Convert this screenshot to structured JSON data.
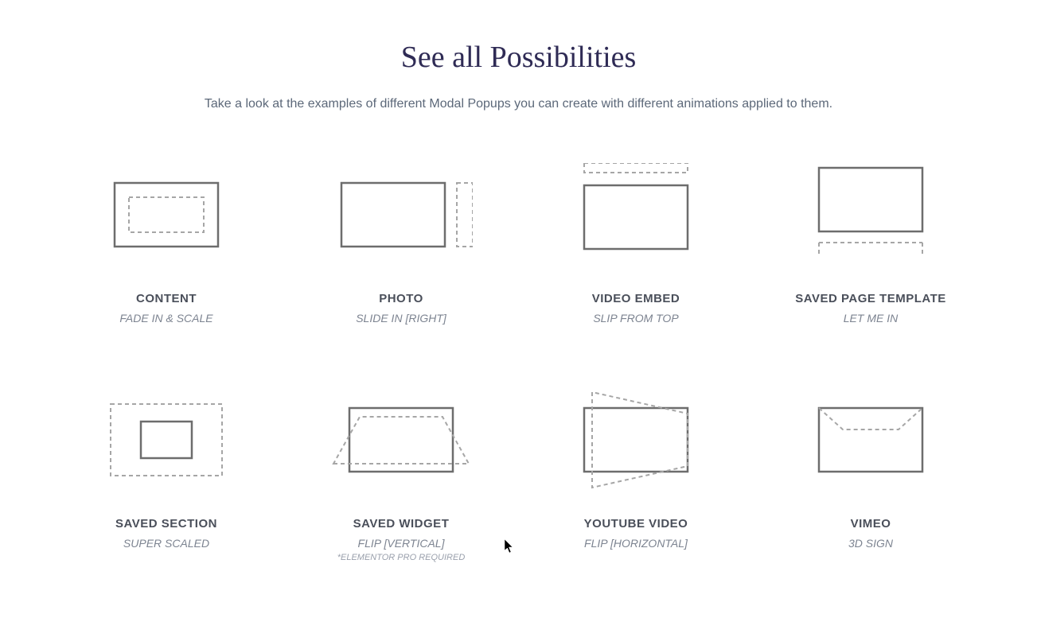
{
  "heading": "See all Possibilities",
  "subheading": "Take a look at the examples of different Modal Popups you can create with different animations applied to them.",
  "cards": [
    {
      "title": "CONTENT",
      "sub": "FADE IN & SCALE",
      "note": ""
    },
    {
      "title": "PHOTO",
      "sub": "SLIDE IN [RIGHT]",
      "note": ""
    },
    {
      "title": "VIDEO EMBED",
      "sub": "SLIP FROM TOP",
      "note": ""
    },
    {
      "title": "SAVED PAGE TEMPLATE",
      "sub": "LET ME IN",
      "note": ""
    },
    {
      "title": "SAVED SECTION",
      "sub": "SUPER SCALED",
      "note": ""
    },
    {
      "title": "SAVED WIDGET",
      "sub": "FLIP [VERTICAL]",
      "note": "*ELEMENTOR PRO REQUIRED"
    },
    {
      "title": "YOUTUBE VIDEO",
      "sub": "FLIP [HORIZONTAL]",
      "note": ""
    },
    {
      "title": "VIMEO",
      "sub": "3D SIGN",
      "note": ""
    }
  ]
}
